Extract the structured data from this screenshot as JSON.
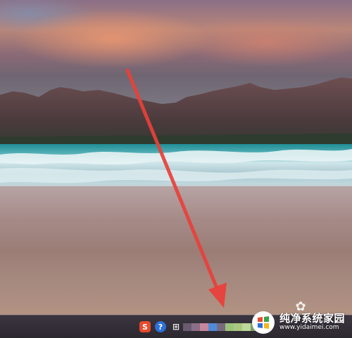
{
  "desktop": {
    "wallpaper": "beach-sunset-mountains"
  },
  "annotation": {
    "arrow_color": "#e8413a",
    "points_to": "taskbar-tray"
  },
  "taskbar": {
    "tray_icons": [
      {
        "name": "sogou-input-icon",
        "glyph": "S",
        "color": "#e74a2c"
      },
      {
        "name": "help-icon",
        "glyph": "?",
        "color": "#2d6fd8"
      },
      {
        "name": "network-icon",
        "glyph": "⊞",
        "color": "#e6e6e6"
      }
    ],
    "pinned_block_colors": [
      "#6b5a70",
      "#8a6f86",
      "#c8869a",
      "#4e8bd8",
      "#7a6a80",
      "#9cc37a",
      "#a8c880",
      "#bcd89a",
      "#7da06a"
    ]
  },
  "watermark": {
    "title": "纯净系统家园",
    "url": "www.yidaimei.com"
  }
}
